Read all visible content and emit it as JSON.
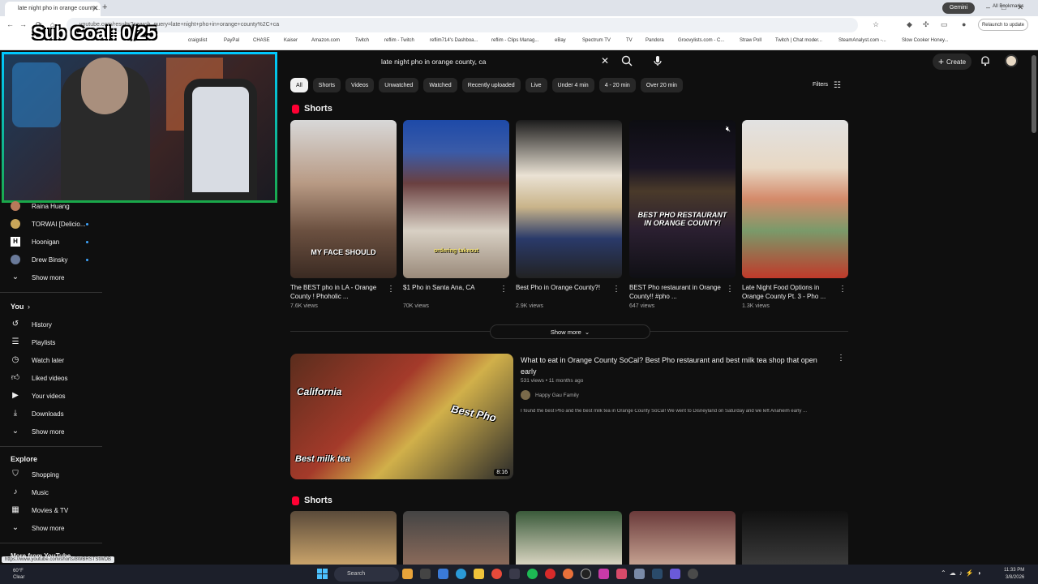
{
  "browser": {
    "tab_title": "late night pho in orange county...",
    "gemini": "Gemini",
    "url": "youtube.com/results?search_query=late+night+pho+in+orange+county%2C+ca",
    "relaunch": "Relaunch to update",
    "all_bookmarks": "All Bookmarks",
    "bookmarks": [
      "craigslist",
      "PayPal",
      "CHASE",
      "Kaiser",
      "Amazon.com",
      "Twitch",
      "reflim - Twitch",
      "reflim714's Dashboa...",
      "reflim - Clips Manag...",
      "eBay",
      "Spectrum TV",
      "TV",
      "Pandora",
      "Groovylists.com - C...",
      "Straw Poll",
      "Twitch | Chat moder...",
      "SteamAnalyst.com -...",
      "Slow Cooker Honey..."
    ]
  },
  "overlay": {
    "sub_goal": "Sub Goal: 0/25"
  },
  "search": {
    "query": "late night pho in orange county, ca"
  },
  "header": {
    "create": "Create"
  },
  "chips": [
    "All",
    "Shorts",
    "Videos",
    "Unwatched",
    "Watched",
    "Recently uploaded",
    "Live",
    "Under 4 min",
    "4 - 20 min",
    "Over 20 min"
  ],
  "filters": "Filters",
  "sidebar": {
    "subs": [
      {
        "label": "Raina Huang",
        "color": "#b87a5a"
      },
      {
        "label": "TORWAI [Delicio...",
        "color": "#c9a65a"
      },
      {
        "label": "Hoonigan",
        "color": "#ffffff"
      },
      {
        "label": "Drew Binsky",
        "color": "#6a7a9a"
      }
    ],
    "show_more_1": "Show more",
    "you_header": "You",
    "you_items": [
      "History",
      "Playlists",
      "Watch later",
      "Liked videos",
      "Your videos",
      "Downloads"
    ],
    "show_more_2": "Show more",
    "explore_header": "Explore",
    "explore_items": [
      "Shopping",
      "Music",
      "Movies & TV"
    ],
    "show_more_3": "Show more",
    "more_from": "More from YouTube"
  },
  "shorts_section_1": {
    "title": "Shorts",
    "items": [
      {
        "title": "The BEST pho in LA - Orange County ! Phoholic ...",
        "views": "7.6K views",
        "overlay": "MY FACE SHOULD"
      },
      {
        "title": "$1 Pho in Santa Ana, CA",
        "views": "70K views",
        "overlay": "ordering takeout"
      },
      {
        "title": "Best Pho in Orange County?!",
        "views": "2.9K views",
        "overlay": ""
      },
      {
        "title": "BEST Pho restaurant in Orange County!! #pho ...",
        "views": "647 views",
        "overlay": "BEST PHO RESTAURANT IN ORANGE COUNTY!"
      },
      {
        "title": "Late Night Food Options in Orange County Pt. 3 - Pho ...",
        "views": "1.3K views",
        "overlay": ""
      }
    ],
    "show_more": "Show more"
  },
  "video": {
    "title": "What to eat in Orange County SoCal? Best Pho restaurant and best milk tea shop that open early",
    "meta": "531 views • 11 months ago",
    "channel": "Happy Gau Family",
    "description": "I found the best Pho and the best milk tea in Orange County SoCal! We went to Disneyland on Saturday and we left Anaheim early ...",
    "duration": "8:16",
    "thumb_texts": [
      "California",
      "Best Pho",
      "Best milk tea"
    ]
  },
  "shorts_section_2": {
    "title": "Shorts"
  },
  "status_url": "https://www.youtube.com/shorts/8WBRSTStWDB",
  "taskbar": {
    "temp": "60°F",
    "weather": "Clear",
    "search": "Search",
    "time": "11:33 PM",
    "date": "3/8/2026"
  }
}
